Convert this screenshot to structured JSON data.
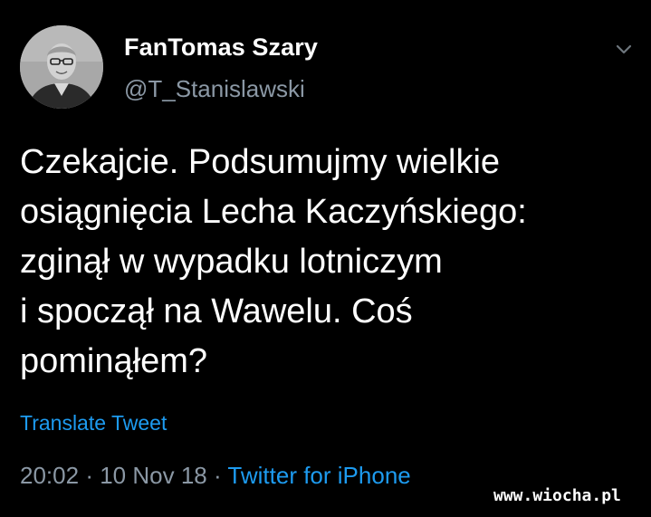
{
  "tweet": {
    "author": {
      "display_name": "FanTomas Szary",
      "handle": "@T_Stanislawski",
      "avatar_icon": "profile-photo"
    },
    "menu_icon": "chevron-down-icon",
    "text_lines": [
      "Czekajcie. Podsumujmy wielkie",
      "osiągnięcia Lecha Kaczyńskiego:",
      "zginął w wypadku lotniczym",
      "i spoczął na Wawelu. Coś",
      "pominąłem?"
    ],
    "translate_label": "Translate Tweet",
    "meta": {
      "time": "20:02",
      "separator": "·",
      "date": "10 Nov 18",
      "source": "Twitter for iPhone"
    }
  },
  "watermark": "www.wiocha.pl",
  "colors": {
    "background": "#000000",
    "primary_text": "#ffffff",
    "secondary_text": "#8b98a5",
    "link": "#1d9bf0"
  }
}
